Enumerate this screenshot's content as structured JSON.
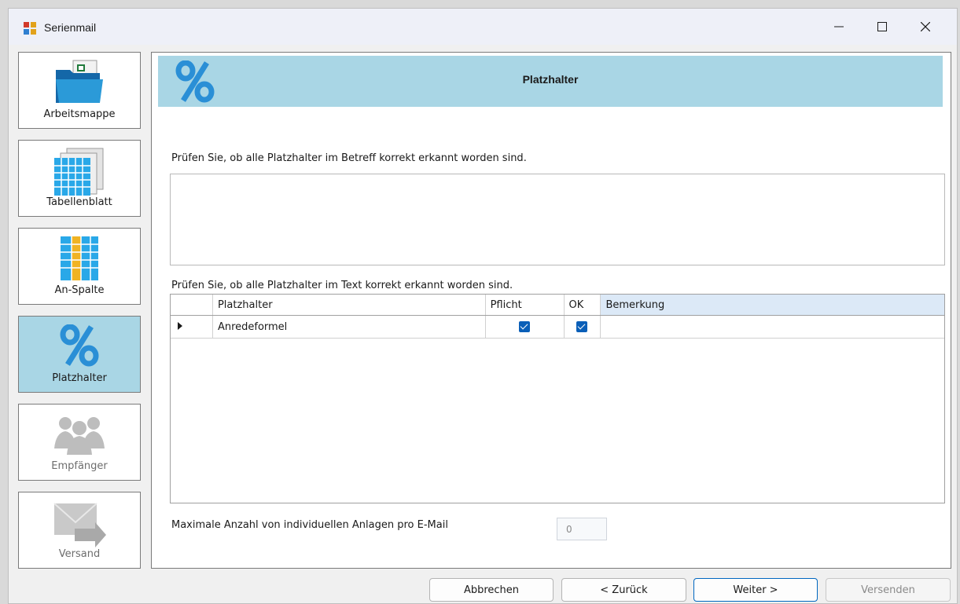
{
  "window": {
    "title": "Serienmail"
  },
  "nav": [
    {
      "label": "Arbeitsmappe",
      "icon": "workbook-folder-icon",
      "state": "normal"
    },
    {
      "label": "Tabellenblatt",
      "icon": "spreadsheet-icon",
      "state": "normal"
    },
    {
      "label": "An-Spalte",
      "icon": "column-icon",
      "state": "normal"
    },
    {
      "label": "Platzhalter",
      "icon": "percent-icon",
      "state": "active"
    },
    {
      "label": "Empfänger",
      "icon": "people-icon",
      "state": "disabled"
    },
    {
      "label": "Versand",
      "icon": "envelope-send-icon",
      "state": "disabled"
    }
  ],
  "header": {
    "title": "Platzhalter",
    "icon": "percent-icon"
  },
  "main": {
    "subject_label": "Prüfen Sie, ob alle Platzhalter im Betreff korrekt erkannt worden sind.",
    "subject_value": "",
    "text_label": "Prüfen Sie, ob alle Platzhalter im Text korrekt erkannt worden sind.",
    "grid": {
      "columns": [
        "Platzhalter",
        "Pflicht",
        "OK",
        "Bemerkung"
      ],
      "rows": [
        {
          "platzhalter": "Anredeformel",
          "pflicht": true,
          "ok": true,
          "bemerkung": ""
        }
      ]
    },
    "attachments_label": "Maximale Anzahl von individuellen Anlagen pro E-Mail",
    "attachments_value": "0"
  },
  "buttons": {
    "cancel": "Abbrechen",
    "back": "< Zurück",
    "next": "Weiter >",
    "send": "Versenden"
  },
  "colors": {
    "accent": "#a9d6e5",
    "checkbox": "#0a5fb8",
    "primary_border": "#0067c0"
  }
}
